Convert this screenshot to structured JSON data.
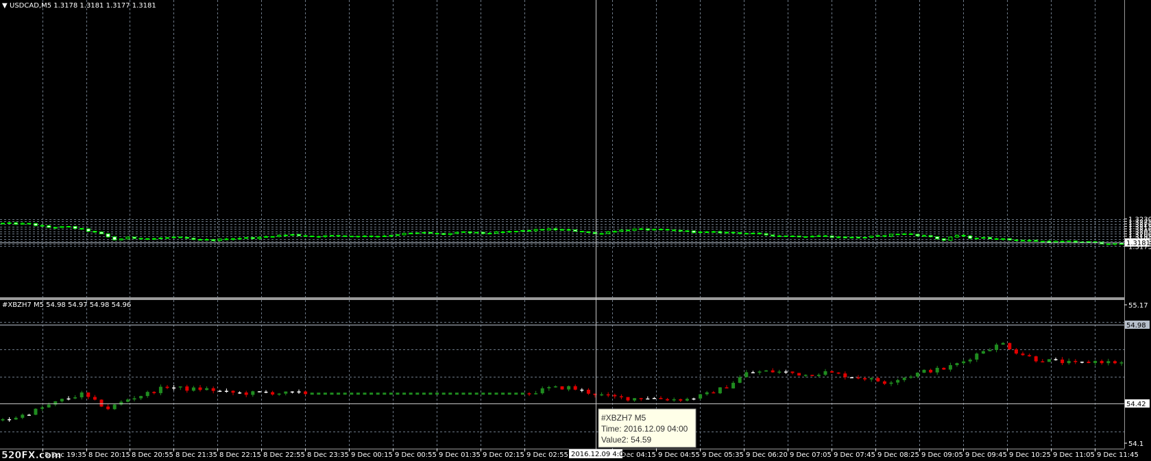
{
  "colors": {
    "background": "#000000",
    "grid": "#6e7a88",
    "bull_top": "#000000",
    "bull_top_border": "#00ff00",
    "bear_top": "#ffffff",
    "wick_top": "#00ff00",
    "bull_sub": "#1f8c1f",
    "bear_sub": "#e00000",
    "doji_sub": "#ffffff",
    "axis_text": "#ffffff",
    "crosshair": "#c8c8c8",
    "divider": "#9a9a9a",
    "price_line": "#b8c0cc",
    "tooltip_bg": "#ffffe8",
    "tooltip_border": "#888888"
  },
  "top_panel": {
    "header_arrow": "▼",
    "header": "USDCAD,M5  1.3178 1.3181 1.3177 1.3181",
    "price_box": "1.3181"
  },
  "sub_panel": {
    "header": "#XBZH7 M5 54.98 54.97 54.98 54.96",
    "price_box": "54.98",
    "crosshair_box": "54.42"
  },
  "tooltip": {
    "line1": "#XBZH7 M5",
    "line2": "Time: 2016.12.09 04:00",
    "line3": "Value2: 54.59"
  },
  "time_cursor_label": "2016.12.09 4:00",
  "watermark": "520FX.com",
  "chart_data": [
    {
      "type": "candlestick",
      "symbol": "USDCAD",
      "timeframe": "M5",
      "ylim": [
        1.317,
        1.323
      ],
      "y_ticks": [
        "1.3230",
        "1.3225",
        "1.3220",
        "1.3215",
        "1.3210",
        "1.3205",
        "1.3200",
        "1.3195",
        "1.3190",
        "1.3185",
        "1.3180",
        "1.3175"
      ],
      "y_tick_values": [
        1.323,
        1.3225,
        1.322,
        1.3215,
        1.321,
        1.3205,
        1.32,
        1.3195,
        1.319,
        1.3185,
        1.318,
        1.3175
      ],
      "x_labels": [
        "8 Dec 19:35",
        "8 Dec 20:15",
        "8 Dec 20:55",
        "8 Dec 21:35",
        "8 Dec 22:15",
        "8 Dec 22:55",
        "8 Dec 23:35",
        "9 Dec 00:15",
        "9 Dec 00:55",
        "9 Dec 01:35",
        "9 Dec 02:15",
        "9 Dec 02:55",
        "9 Dec 04:15",
        "9 Dec 04:55",
        "9 Dec 05:35",
        "9 Dec 06:20",
        "9 Dec 07:05",
        "9 Dec 07:45",
        "9 Dec 08:25",
        "9 Dec 09:05",
        "9 Dec 09:45",
        "9 Dec 10:25",
        "9 Dec 11:05",
        "9 Dec 11:45"
      ],
      "close_path": [
        [
          0,
          1.3221
        ],
        [
          8,
          1.322
        ],
        [
          14,
          1.3213
        ],
        [
          20,
          1.3214
        ],
        [
          26,
          1.3206
        ],
        [
          30,
          1.3199
        ],
        [
          34,
          1.3188
        ],
        [
          38,
          1.3192
        ],
        [
          46,
          1.319
        ],
        [
          52,
          1.3193
        ],
        [
          58,
          1.3188
        ],
        [
          64,
          1.3187
        ],
        [
          70,
          1.3191
        ],
        [
          78,
          1.3192
        ],
        [
          82,
          1.3196
        ],
        [
          88,
          1.3198
        ],
        [
          94,
          1.3195
        ],
        [
          102,
          1.3196
        ],
        [
          110,
          1.3195
        ],
        [
          116,
          1.3196
        ],
        [
          122,
          1.32
        ],
        [
          128,
          1.3202
        ],
        [
          134,
          1.3199
        ],
        [
          140,
          1.3203
        ],
        [
          146,
          1.3201
        ],
        [
          152,
          1.3203
        ],
        [
          158,
          1.3206
        ],
        [
          166,
          1.3209
        ],
        [
          170,
          1.3208
        ],
        [
          176,
          1.3205
        ],
        [
          180,
          1.32
        ],
        [
          186,
          1.3206
        ],
        [
          192,
          1.3209
        ],
        [
          198,
          1.3208
        ],
        [
          206,
          1.3206
        ],
        [
          212,
          1.3203
        ],
        [
          218,
          1.3203
        ],
        [
          224,
          1.3202
        ],
        [
          230,
          1.3199
        ],
        [
          236,
          1.3196
        ],
        [
          242,
          1.3195
        ],
        [
          248,
          1.3196
        ],
        [
          254,
          1.3193
        ],
        [
          260,
          1.3192
        ],
        [
          266,
          1.3195
        ],
        [
          272,
          1.32
        ],
        [
          276,
          1.3199
        ],
        [
          282,
          1.3194
        ],
        [
          286,
          1.3187
        ],
        [
          290,
          1.3197
        ],
        [
          294,
          1.3192
        ],
        [
          300,
          1.3191
        ],
        [
          306,
          1.3188
        ],
        [
          312,
          1.3186
        ],
        [
          318,
          1.3184
        ],
        [
          324,
          1.3184
        ],
        [
          330,
          1.3183
        ],
        [
          336,
          1.318
        ],
        [
          340,
          1.3179
        ]
      ]
    },
    {
      "type": "candlestick",
      "symbol": "#XBZH7",
      "timeframe": "M5",
      "ylim": [
        54.07,
        55.18
      ],
      "y_ticks": [
        "55.17",
        "54.1"
      ],
      "y_tick_values": [
        55.17,
        54.1
      ],
      "close_path": [
        [
          0,
          54.22
        ],
        [
          6,
          54.28
        ],
        [
          12,
          54.37
        ],
        [
          18,
          54.46
        ],
        [
          24,
          54.53
        ],
        [
          28,
          54.44
        ],
        [
          32,
          54.36
        ],
        [
          38,
          54.47
        ],
        [
          44,
          54.54
        ],
        [
          50,
          54.62
        ],
        [
          56,
          54.59
        ],
        [
          62,
          54.59
        ],
        [
          68,
          54.55
        ],
        [
          74,
          54.54
        ],
        [
          80,
          54.55
        ],
        [
          86,
          54.54
        ],
        [
          92,
          54.54
        ],
        [
          160,
          54.54
        ],
        [
          166,
          54.6
        ],
        [
          172,
          54.61
        ],
        [
          178,
          54.55
        ],
        [
          184,
          54.5
        ],
        [
          190,
          54.48
        ],
        [
          196,
          54.49
        ],
        [
          202,
          54.47
        ],
        [
          208,
          54.47
        ],
        [
          214,
          54.53
        ],
        [
          220,
          54.62
        ],
        [
          226,
          54.78
        ],
        [
          232,
          54.8
        ],
        [
          238,
          54.79
        ],
        [
          244,
          54.76
        ],
        [
          250,
          54.79
        ],
        [
          256,
          54.75
        ],
        [
          262,
          54.72
        ],
        [
          268,
          54.67
        ],
        [
          274,
          54.73
        ],
        [
          280,
          54.8
        ],
        [
          286,
          54.83
        ],
        [
          292,
          54.92
        ],
        [
          298,
          55.05
        ],
        [
          304,
          55.13
        ],
        [
          308,
          55.03
        ],
        [
          314,
          54.94
        ],
        [
          320,
          54.92
        ],
        [
          326,
          54.89
        ],
        [
          332,
          54.92
        ],
        [
          340,
          54.9
        ]
      ]
    }
  ]
}
